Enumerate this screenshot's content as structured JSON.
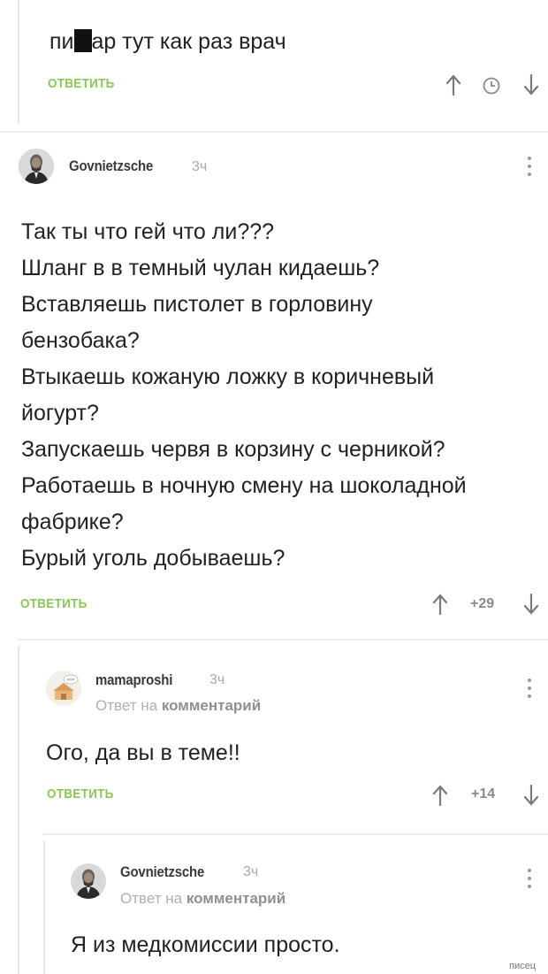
{
  "comment0": {
    "text_before": "пи",
    "text_after": "ар тут как раз врач",
    "reply_label": "ОТВЕТИТЬ"
  },
  "comment1": {
    "username": "Govnietzsche",
    "time": "3ч",
    "lines": [
      "Так ты что гей что ли???",
      "Шланг в в темный чулан кидаешь?",
      "Вставляешь пистолет в горловину",
      "бензобака?",
      "Втыкаешь кожаную ложку в коричневый",
      "йогурт?",
      "Запускаешь червя в корзину с черникой?",
      "Работаешь в ночную смену на шоколадной",
      "фабрике?",
      "Бурый уголь добываешь?"
    ],
    "reply_label": "ОТВЕТИТЬ",
    "score": "+29"
  },
  "comment2": {
    "username": "mamaproshi",
    "time": "3ч",
    "reply_to_prefix": "Ответ на",
    "reply_to_link": "комментарий",
    "text": "Ого, да вы в теме!!",
    "reply_label": "ОТВЕТИТЬ",
    "score": "+14"
  },
  "comment3": {
    "username": "Govnietzsche",
    "time": "3ч",
    "reply_to_prefix": "Ответ на",
    "reply_to_link": "комментарий",
    "text": "Я из медкомиссии просто."
  },
  "watermark": "писец"
}
